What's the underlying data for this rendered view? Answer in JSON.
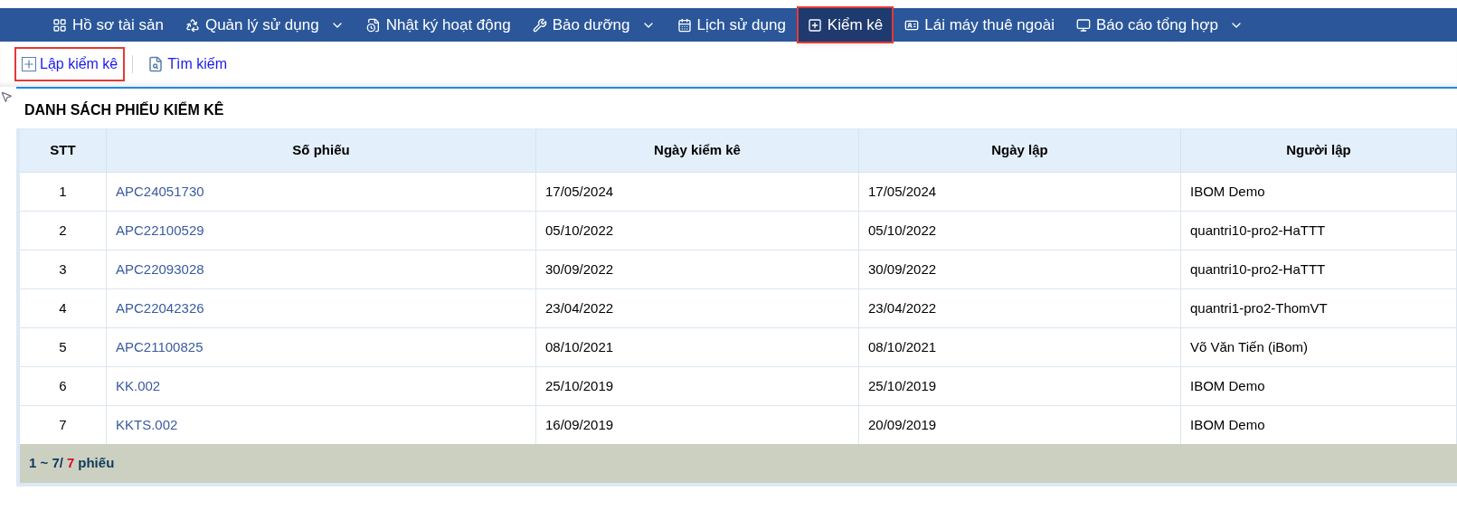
{
  "nav": [
    {
      "label": "Hồ sơ tài sản",
      "dropdown": false,
      "selected": false
    },
    {
      "label": "Quản lý sử dụng",
      "dropdown": true,
      "selected": false
    },
    {
      "label": "Nhật ký hoạt động",
      "dropdown": false,
      "selected": false
    },
    {
      "label": "Bảo dưỡng",
      "dropdown": true,
      "selected": false
    },
    {
      "label": "Lịch sử dụng",
      "dropdown": false,
      "selected": false
    },
    {
      "label": "Kiểm kê",
      "dropdown": false,
      "selected": true
    },
    {
      "label": "Lái máy thuê ngoài",
      "dropdown": false,
      "selected": false
    },
    {
      "label": "Báo cáo tổng hợp",
      "dropdown": true,
      "selected": false
    }
  ],
  "toolbar": [
    {
      "label": "Lập kiểm kê",
      "highlighted": true
    },
    {
      "label": "Tìm kiếm",
      "highlighted": false
    }
  ],
  "section_title": "DANH SÁCH PHIẾU KIỂM KÊ",
  "table": {
    "columns": [
      "STT",
      "Số phiếu",
      "Ngày kiểm kê",
      "Ngày lập",
      "Người lập"
    ],
    "rows": [
      [
        "1",
        "APC24051730",
        "17/05/2024",
        "17/05/2024",
        "IBOM Demo"
      ],
      [
        "2",
        "APC22100529",
        "05/10/2022",
        "05/10/2022",
        "quantri10-pro2-HaTTT"
      ],
      [
        "3",
        "APC22093028",
        "30/09/2022",
        "30/09/2022",
        "quantri10-pro2-HaTTT"
      ],
      [
        "4",
        "APC22042326",
        "23/04/2022",
        "23/04/2022",
        "quantri1-pro2-ThomVT"
      ],
      [
        "5",
        "APC21100825",
        "08/10/2021",
        "08/10/2021",
        "Võ Văn Tiến (iBom)"
      ],
      [
        "6",
        "KK.002",
        "25/10/2019",
        "25/10/2019",
        "IBOM Demo"
      ],
      [
        "7",
        "KKTS.002",
        "16/09/2019",
        "20/09/2019",
        "IBOM Demo"
      ]
    ]
  },
  "footer": {
    "range": "1 ~ 7/",
    "total": "7",
    "unit": "phiếu"
  }
}
